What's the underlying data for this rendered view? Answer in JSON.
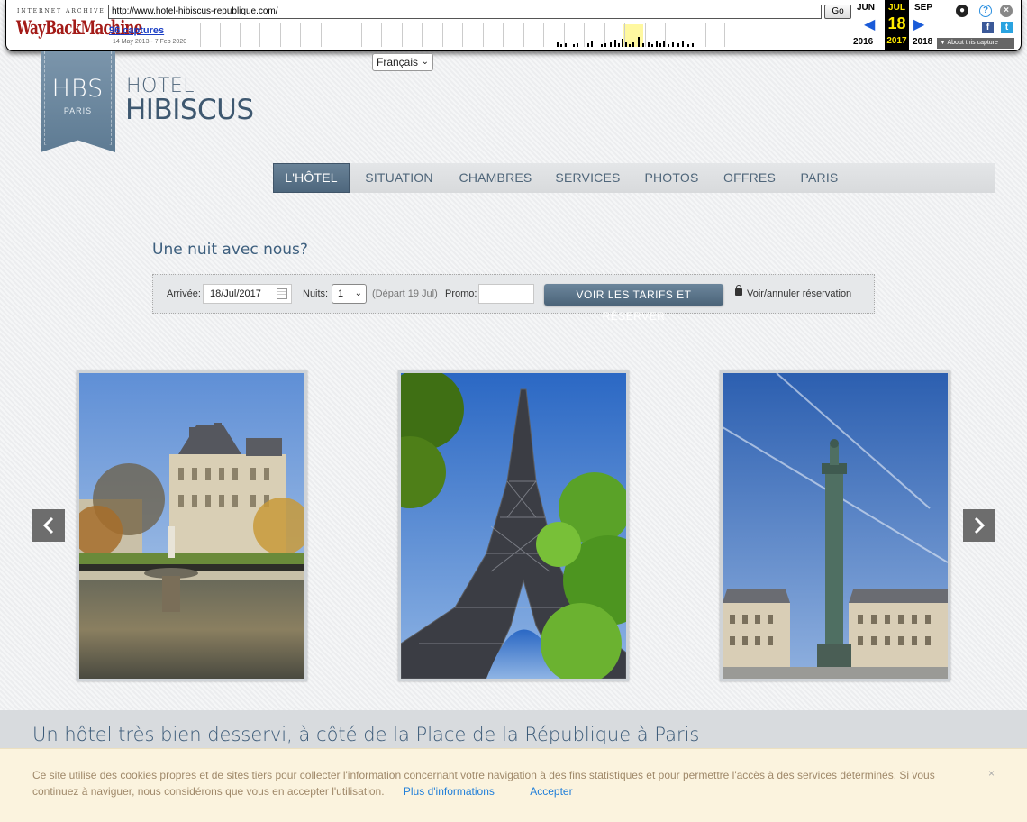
{
  "wayback": {
    "logo_top": "INTERNET ARCHIVE",
    "logo": "WayBackMachine",
    "url": "http://www.hotel-hibiscus-republique.com/",
    "go_label": "Go",
    "captures": "96 captures",
    "date_range": "14 May 2013 - 7 Feb 2020",
    "prev_month": "JUN",
    "cur_month": "JUL",
    "next_month": "SEP",
    "cur_day": "18",
    "prev_year": "2016",
    "cur_year": "2017",
    "next_year": "2018",
    "about_label": "About this capture",
    "facebook_glyph": "f",
    "twitter_glyph": "t"
  },
  "language": {
    "selected": "Français"
  },
  "logo": {
    "monogram": "HBS",
    "city": "PARIS",
    "line1": "HOTEL",
    "line2": "HIBISCUS"
  },
  "nav": {
    "items": [
      {
        "label": "L'HÔTEL",
        "active": true
      },
      {
        "label": "SITUATION",
        "active": false
      },
      {
        "label": "CHAMBRES",
        "active": false
      },
      {
        "label": "SERVICES",
        "active": false
      },
      {
        "label": "PHOTOS",
        "active": false
      },
      {
        "label": "OFFRES",
        "active": false
      },
      {
        "label": "PARIS",
        "active": false
      }
    ]
  },
  "booking": {
    "title": "Une nuit avec nous?",
    "arrival_label": "Arrivée:",
    "arrival_value": "18/Jul/2017",
    "nights_label": "Nuits:",
    "nights_value": "1",
    "departure_note": "(Départ 19 Jul)",
    "promo_label": "Promo:",
    "promo_value": "",
    "submit_label": "VOIR LES TARIFS ET RÉSERVER",
    "manage_link": "Voir/annuler réservation"
  },
  "carousel": {
    "photos": [
      {
        "subject": "Tuileries garden and Louvre"
      },
      {
        "subject": "Eiffel Tower"
      },
      {
        "subject": "Place Vendôme column"
      }
    ]
  },
  "footer": {
    "headline": "Un hôtel très bien desservi, à côté de la Place de la République à Paris"
  },
  "cookie": {
    "text": "Ce site utilise des cookies propres et de sites tiers pour collecter l'information concernant votre navigation à des fins statistiques et pour permettre l'accès à des services déterminés. Si vous continuez à naviguer, nous considérons que vous en accepter l'utilisation.",
    "more_link": "Plus d'informations",
    "accept_link": "Accepter",
    "close_glyph": "×"
  },
  "colors": {
    "accent": "#4d667c",
    "link": "#1f7ed9",
    "wayback_red": "#a31b18",
    "cookie_bg": "#fbf3de"
  }
}
